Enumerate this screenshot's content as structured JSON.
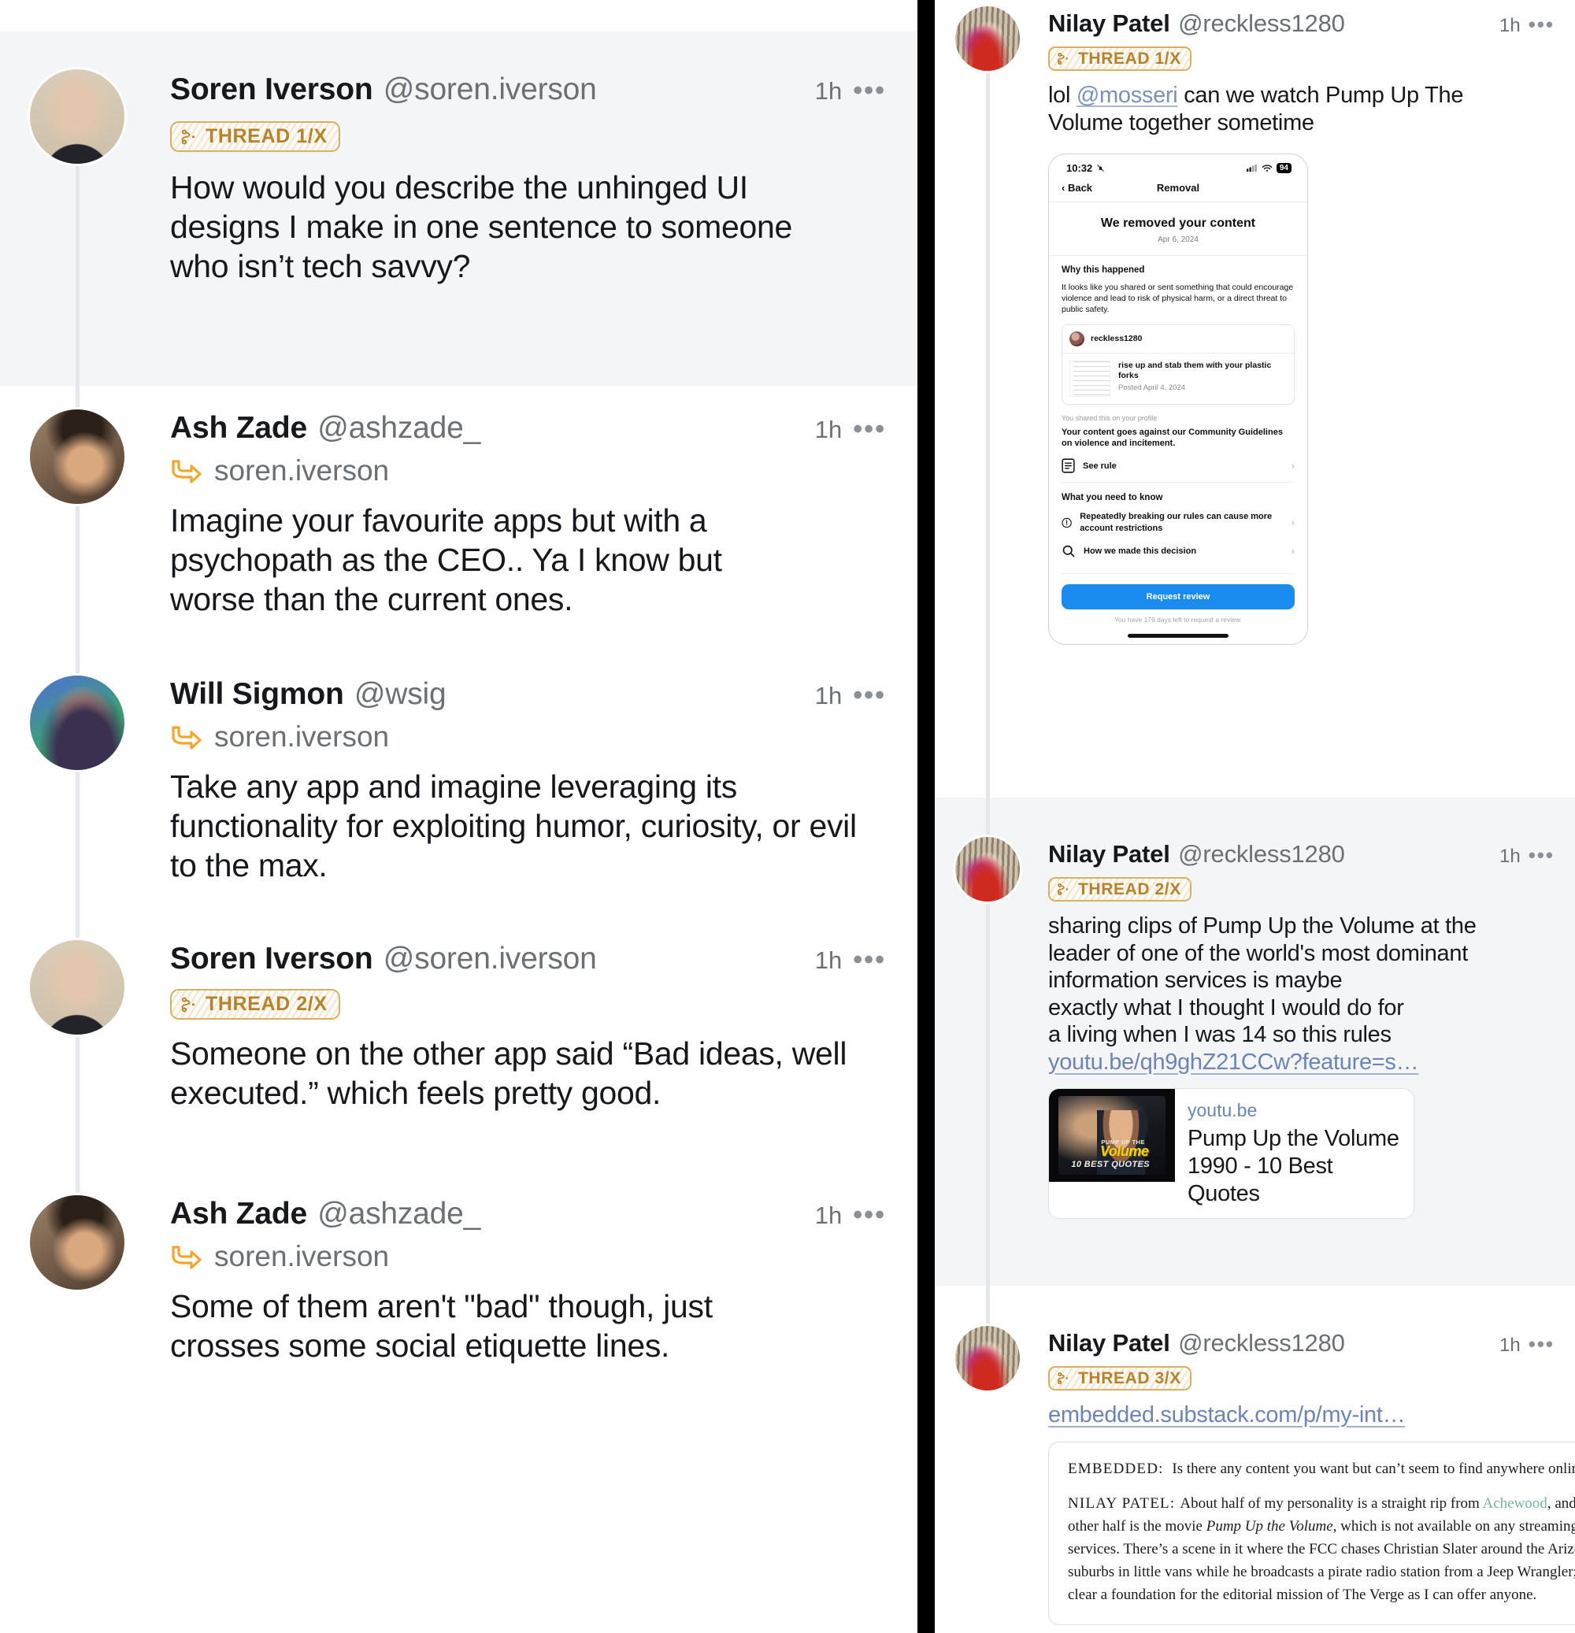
{
  "colors": {
    "badge_border": "#d9b062",
    "badge_text": "#b4832c",
    "reply_arrow": "#f2a72c",
    "link_blue": "#6d84b4",
    "mention_blue": "#7c90b8",
    "highlight_bg": "#f4f5f7",
    "divider": "#000000",
    "thread_line": "#e6e7e9",
    "substack_link": "#74b6a4",
    "phone_button": "#1a8cf0"
  },
  "left_panel": {
    "posts": [
      {
        "display_name": "Soren Iverson",
        "handle": "@soren.iverson",
        "time": "1h",
        "more": "•••",
        "badge": "THREAD 1/X",
        "text": "How would you describe the unhinged UI designs I make in one sentence to someone who isn’t tech savvy?",
        "highlighted": true
      },
      {
        "display_name": "Ash Zade",
        "handle": "@ashzade_",
        "time": "1h",
        "more": "•••",
        "reply_to": "soren.iverson",
        "text": "Imagine your favourite apps but with a psychopath as the CEO.. Ya I know but worse than the current ones.",
        "highlighted": false
      },
      {
        "display_name": "Will Sigmon",
        "handle": "@wsig",
        "time": "1h",
        "more": "•••",
        "reply_to": "soren.iverson",
        "text": "Take any app and imagine leveraging its functionality for exploiting humor, curiosity, or evil to the max.",
        "highlighted": false
      },
      {
        "display_name": "Soren Iverson",
        "handle": "@soren.iverson",
        "time": "1h",
        "more": "•••",
        "badge": "THREAD 2/X",
        "text": "Someone on the other app said “Bad ideas, well executed.” which feels pretty good.",
        "highlighted": false
      },
      {
        "display_name": "Ash Zade",
        "handle": "@ashzade_",
        "time": "1h",
        "more": "•••",
        "reply_to": "soren.iverson",
        "text": "Some of them aren't \"bad\" though, just crosses some social etiquette lines.",
        "highlighted": false
      }
    ]
  },
  "right_panel": {
    "posts": [
      {
        "display_name": "Nilay Patel",
        "handle": "@reckless1280",
        "time": "1h",
        "more": "•••",
        "badge": "THREAD 1/X",
        "text_before": "lol ",
        "mention": "@mosseri",
        "text_after": " can we watch Pump Up The Volume together sometime",
        "highlighted": false
      },
      {
        "display_name": "Nilay Patel",
        "handle": "@reckless1280",
        "time": "1h",
        "more": "•••",
        "badge": "THREAD 2/X",
        "text": "sharing clips of Pump Up the Volume at the leader of one of the world's most dominant information services is maybe",
        "text2": "exactly what I thought I would do for",
        "text3": "a living when I was 14 so this rules",
        "link": "youtu.be/qh9ghZ21CCw?feature=s…",
        "highlighted": true
      },
      {
        "display_name": "Nilay Patel",
        "handle": "@reckless1280",
        "time": "1h",
        "more": "•••",
        "badge": "THREAD 3/X",
        "link": "embedded.substack.com/p/my-int…",
        "highlighted": false
      }
    ]
  },
  "phone_mock": {
    "status_time": "10:32",
    "battery": "94",
    "back_label": "Back",
    "nav_title": "Removal",
    "headline": "We removed your content",
    "date": "Apr 6, 2024",
    "why_heading": "Why this happened",
    "why_body": "It looks like you shared or sent something that could encourage violence and lead to risk of physical harm, or a direct threat to public safety.",
    "card_user": "reckless1280",
    "card_title": "rise up and stab them with your plastic forks",
    "card_posted": "Posted April 4, 2024",
    "shared_note": "You shared this on your profile",
    "violation": "Your content goes against our Community Guidelines on violence and incitement.",
    "see_rule": "See rule",
    "need_heading": "What you need to know",
    "row1": "Repeatedly breaking our rules can cause more account restrictions",
    "row2": "How we made this decision",
    "button": "Request review",
    "note": "You have 179 days left to request a review.",
    "chevron": "›"
  },
  "youtube_card": {
    "domain": "youtu.be",
    "title_line1": "Pump Up the Volume",
    "title_line2": "1990 - 10 Best Quotes",
    "thumb_logo_top": "PUMP UP THE",
    "thumb_logo_main": "Volume",
    "thumb_caption": "10 BEST QUOTES"
  },
  "substack_embed": {
    "q_label": "EMBEDDED:",
    "q_text": "Is there any content you want but can’t seem to find anywhere online?",
    "a_label": "NILAY PATEL:",
    "a_part1": "About half of my personality is a straight rip from ",
    "a_link": "Achewood",
    "a_part2": ", and the other half is the movie ",
    "a_italic": "Pump Up the Volume",
    "a_part3": ", which is not available on any streaming services. There’s a scene in it where the FCC chases Christian Slater around the Arizona suburbs in little vans while he broadcasts a pirate radio station from a Jeep Wrangler; it is as clear a foundation for the editorial mission of The Verge as I can offer anyone."
  }
}
